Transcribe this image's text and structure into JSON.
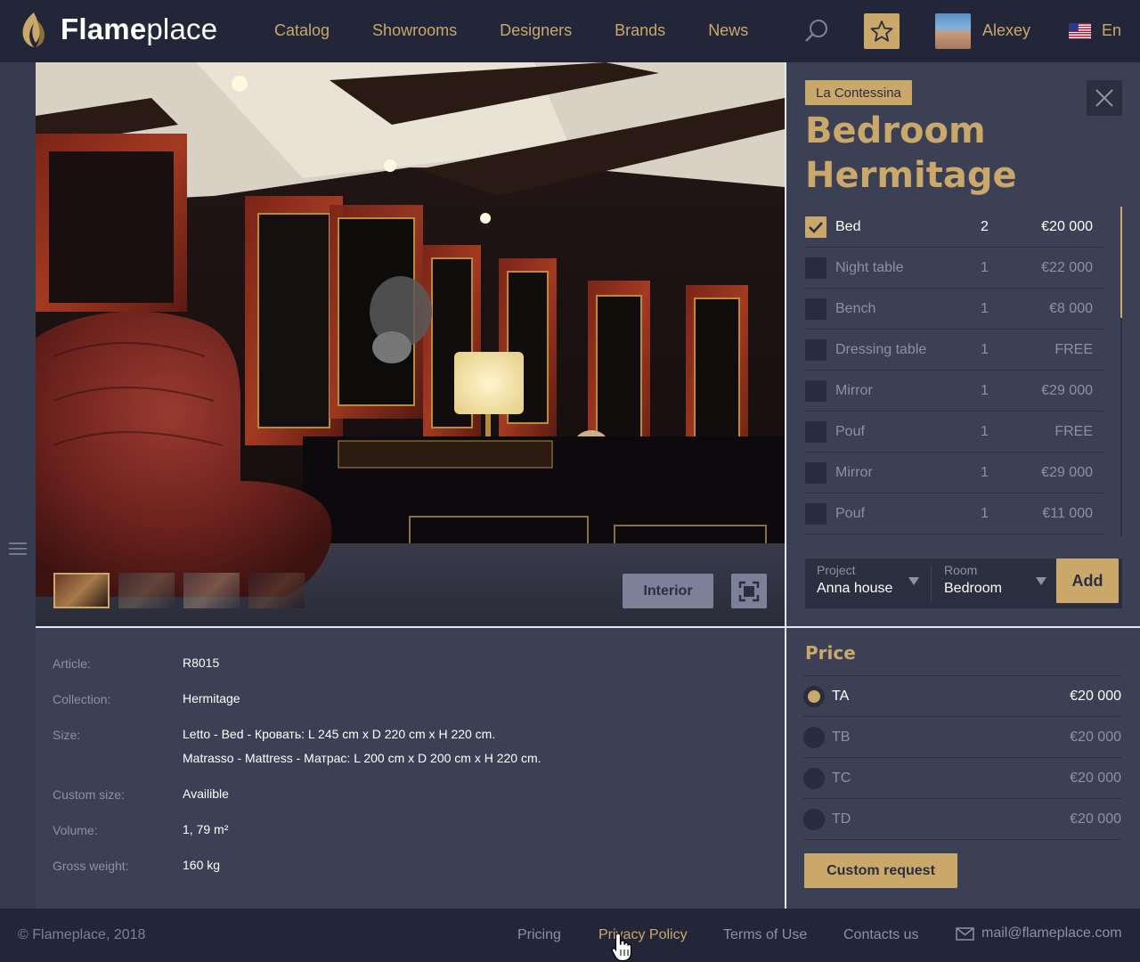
{
  "header": {
    "logo_bold": "Flame",
    "logo_light": "place",
    "nav": [
      "Catalog",
      "Showrooms",
      "Designers",
      "Brands",
      "News"
    ],
    "user_name": "Alexey",
    "language": "En"
  },
  "viewer": {
    "thumbnail_count": 4,
    "active_thumbnail": 1,
    "interior_label": "Interior"
  },
  "product": {
    "brand": "La Contessina",
    "title": "Bedroom Hermitage",
    "items": [
      {
        "name": "Bed",
        "qty": "2",
        "price": "€20 000",
        "checked": true
      },
      {
        "name": "Night table",
        "qty": "1",
        "price": "€22 000",
        "checked": false
      },
      {
        "name": "Bench",
        "qty": "1",
        "price": "€8 000",
        "checked": false
      },
      {
        "name": "Dressing table",
        "qty": "1",
        "price": "FREE",
        "checked": false
      },
      {
        "name": "Mirror",
        "qty": "1",
        "price": "€29 000",
        "checked": false
      },
      {
        "name": "Pouf",
        "qty": "1",
        "price": "FREE",
        "checked": false
      },
      {
        "name": "Mirror",
        "qty": "1",
        "price": "€29 000",
        "checked": false
      },
      {
        "name": "Pouf",
        "qty": "1",
        "price": "€11 000",
        "checked": false
      }
    ]
  },
  "add_bar": {
    "project_label": "Project",
    "project_value": "Anna house",
    "room_label": "Room",
    "room_value": "Bedroom",
    "add_label": "Add"
  },
  "details": {
    "article_label": "Article:",
    "article": "R8015",
    "collection_label": "Collection:",
    "collection": "Hermitage",
    "size_label": "Size:",
    "size_line1": "Letto - Bed - Кровать: L 245 cm x D 220 cm x H 220 cm.",
    "size_line2": "Matrasso - Mattress - Матрас: L 200 cm x D 200 cm x H 220 cm.",
    "custom_size_label": "Custom size:",
    "custom_size": "Availible",
    "volume_label": "Volume:",
    "volume": "1, 79 m²",
    "weight_label": "Gross weight:",
    "weight": "160 kg"
  },
  "price": {
    "title": "Price",
    "options": [
      {
        "name": "TA",
        "value": "€20 000",
        "selected": true
      },
      {
        "name": "TB",
        "value": "€20 000",
        "selected": false
      },
      {
        "name": "TC",
        "value": "€20 000",
        "selected": false
      },
      {
        "name": "TD",
        "value": "€20 000",
        "selected": false
      }
    ],
    "custom_request": "Custom request"
  },
  "footer": {
    "copyright": "© Flameplace, 2018",
    "links": [
      "Pricing",
      "Privacy Policy",
      "Terms of Use",
      "Contacts us"
    ],
    "email": "mail@flameplace.com"
  },
  "colors": {
    "accent": "#c9a86a",
    "background": "#1f2333",
    "panel": "#3b4055",
    "header": "#222638"
  }
}
